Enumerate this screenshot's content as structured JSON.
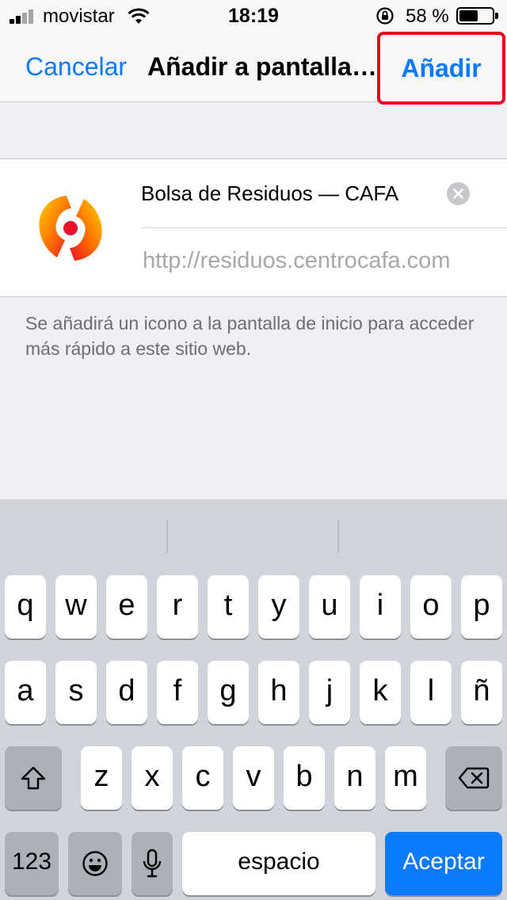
{
  "status_bar": {
    "carrier": "movistar",
    "time": "18:19",
    "battery_text": "58 %",
    "battery_level": 0.58
  },
  "nav": {
    "cancel_label": "Cancelar",
    "title": "Añadir a pantalla de inicio",
    "add_label": "Añadir"
  },
  "bookmark": {
    "title_value": "Bolsa de Residuos — CAFA",
    "url_value": "http://residuos.centrocafa.com",
    "icon": "cafa-logo-icon"
  },
  "hint_text": "Se añadirá un icono a la pantalla de inicio para acceder más rápido a este sitio web.",
  "keyboard": {
    "row1": [
      "q",
      "w",
      "e",
      "r",
      "t",
      "y",
      "u",
      "i",
      "o",
      "p"
    ],
    "row2": [
      "a",
      "s",
      "d",
      "f",
      "g",
      "h",
      "j",
      "k",
      "l",
      "ñ"
    ],
    "row3": [
      "z",
      "x",
      "c",
      "v",
      "b",
      "n",
      "m"
    ],
    "numbers_label": "123",
    "space_label": "espacio",
    "return_label": "Aceptar",
    "icons": [
      "shift-icon",
      "backspace-icon",
      "emoji-icon",
      "microphone-icon"
    ]
  },
  "colors": {
    "accent": "#0a7aff",
    "highlight_border": "#e8001e"
  }
}
